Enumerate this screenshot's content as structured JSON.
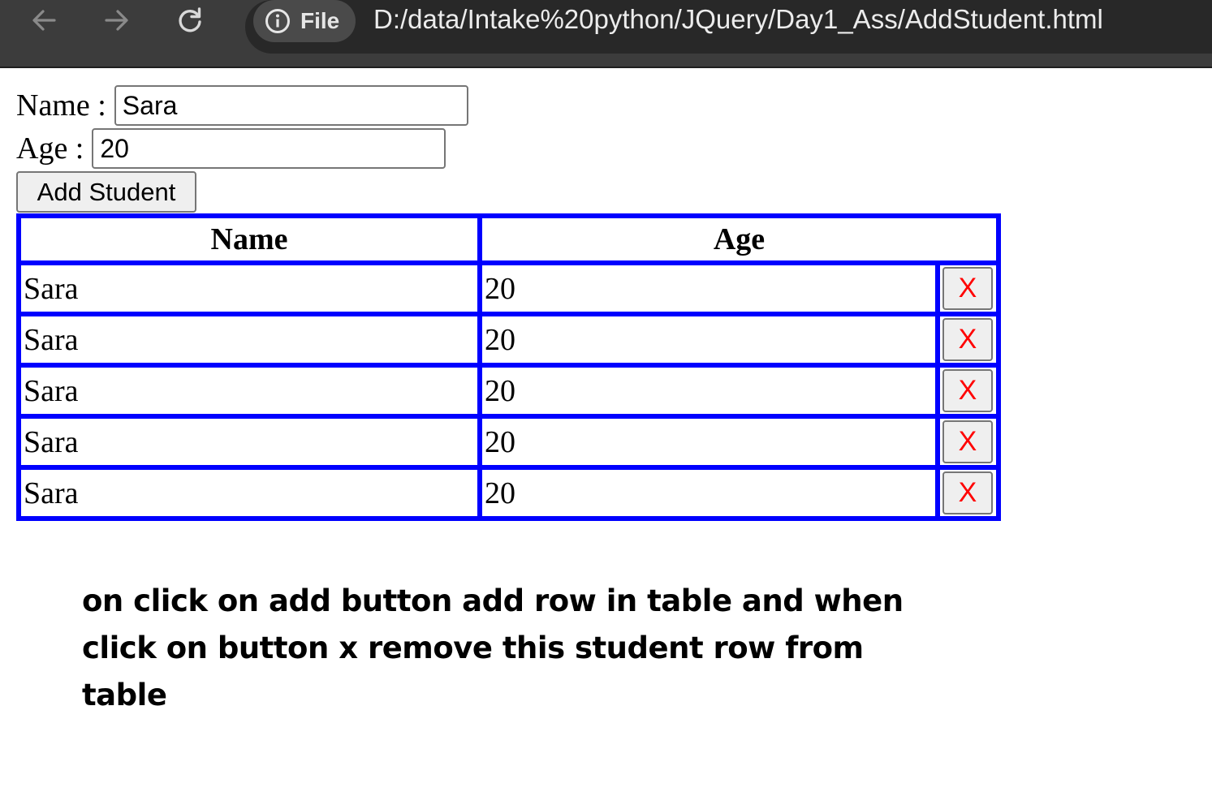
{
  "browser": {
    "site_chip_label": "File",
    "url": "D:/data/Intake%20python/JQuery/Day1_Ass/AddStudent.html",
    "icons": [
      "back-arrow-icon",
      "forward-arrow-icon",
      "reload-icon",
      "info-icon"
    ]
  },
  "form": {
    "name_label": "Name :",
    "name_value": "Sara",
    "age_label": "Age :",
    "age_value": "20",
    "add_button_label": "Add Student"
  },
  "table": {
    "headers": [
      "Name",
      "Age"
    ],
    "border_color": "#0000ff",
    "remove_button_label": "X",
    "remove_button_color": "#ff0000",
    "rows": [
      {
        "name": "Sara",
        "age": "20"
      },
      {
        "name": "Sara",
        "age": "20"
      },
      {
        "name": "Sara",
        "age": "20"
      },
      {
        "name": "Sara",
        "age": "20"
      },
      {
        "name": "Sara",
        "age": "20"
      }
    ]
  },
  "note": {
    "line1": "on click on add button add row in table and when",
    "line2": "click on button x remove this student row from",
    "line3": "table"
  }
}
